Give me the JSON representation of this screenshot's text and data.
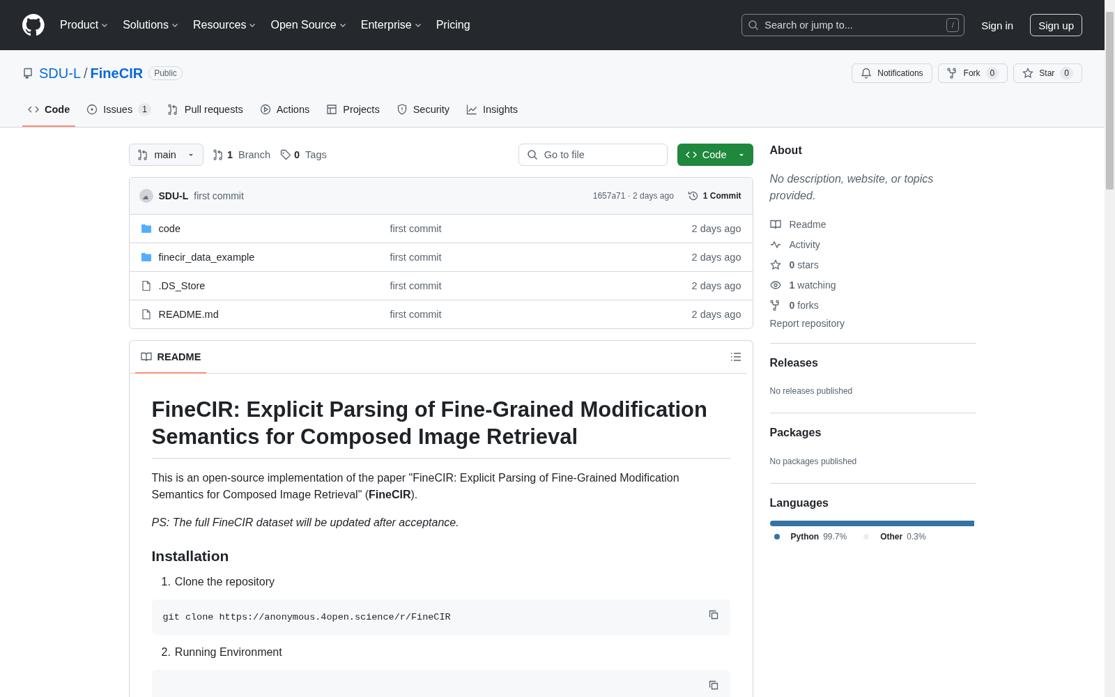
{
  "header": {
    "nav": [
      {
        "label": "Product",
        "caret": true
      },
      {
        "label": "Solutions",
        "caret": true
      },
      {
        "label": "Resources",
        "caret": true
      },
      {
        "label": "Open Source",
        "caret": true
      },
      {
        "label": "Enterprise",
        "caret": true
      },
      {
        "label": "Pricing",
        "caret": false
      }
    ],
    "search": {
      "placeholder": "Search or jump to...",
      "shortcut": "/"
    },
    "sign_in": "Sign in",
    "sign_up": "Sign up"
  },
  "repo": {
    "owner": "SDU-L",
    "separator": "/",
    "name": "FineCIR",
    "visibility": "Public",
    "actions": [
      {
        "kind": "bell",
        "label": "Notifications"
      },
      {
        "kind": "fork",
        "label": "Fork",
        "count": "0"
      },
      {
        "kind": "star",
        "label": "Star",
        "count": "0"
      }
    ]
  },
  "tabs": [
    {
      "kind": "code",
      "label": "Code",
      "selected": true
    },
    {
      "kind": "issue",
      "label": "Issues",
      "count": "1",
      "selected": false
    },
    {
      "kind": "pr",
      "label": "Pull requests",
      "selected": false
    },
    {
      "kind": "play",
      "label": "Actions",
      "selected": false
    },
    {
      "kind": "table",
      "label": "Projects",
      "selected": false
    },
    {
      "kind": "shield",
      "label": "Security",
      "selected": false
    },
    {
      "kind": "graph",
      "label": "Insights",
      "selected": false
    }
  ],
  "toolbar": {
    "branch": "main",
    "branches_count": "1",
    "branches_label": "Branch",
    "tags_count": "0",
    "tags_label": "Tags",
    "go_to_file": {
      "placeholder": "Go to file"
    },
    "code_button": "Code"
  },
  "commit": {
    "author": "SDU-L",
    "message": "first commit",
    "hash_time": "1657a71 · 2 days ago",
    "commits": "1 Commit"
  },
  "files": [
    {
      "kind": "folder",
      "name": "code",
      "message": "first commit",
      "time": "2 days ago"
    },
    {
      "kind": "folder",
      "name": "finecir_data_example",
      "message": "first commit",
      "time": "2 days ago"
    },
    {
      "kind": "file",
      "name": ".DS_Store",
      "message": "first commit",
      "time": "2 days ago"
    },
    {
      "kind": "file",
      "name": "README.md",
      "message": "first commit",
      "time": "2 days ago"
    }
  ],
  "readme": {
    "tab": "README",
    "title": "FineCIR: Explicit Parsing of Fine-Grained Modification Semantics for Composed Image Retrieval",
    "intro": "This is an open-source implementation of the paper \"FineCIR: Explicit Parsing of Fine-Grained Modification Semantics for Composed Image Retrieval\" (**FineCIR**).",
    "note": "PS: The full FineCIR dataset will be updated after acceptance.",
    "section": "Installation",
    "steps": [
      {
        "number": "1.",
        "text": "Clone the repository",
        "code": "git clone https://anonymous.4open.science/r/FineCIR"
      },
      {
        "number": "2.",
        "text": "Running Environment"
      }
    ]
  },
  "sidebar": {
    "about_title": "About",
    "about_text": "No description, website, or topics provided.",
    "links": [
      {
        "kind": "book",
        "label": "Readme"
      },
      {
        "kind": "pulse",
        "label": "Activity"
      },
      {
        "kind": "star",
        "count": "0",
        "label": "stars"
      },
      {
        "kind": "eye",
        "count": "1",
        "label": "watching"
      },
      {
        "kind": "fork",
        "count": "0",
        "label": "forks"
      }
    ],
    "report": "Report repository",
    "releases_title": "Releases",
    "releases_text": "No releases published",
    "packages_title": "Packages",
    "packages_text": "No packages published",
    "languages_title": "Languages",
    "languages": [
      {
        "name": "Python",
        "percent": "99.7%",
        "color": "#3572a5",
        "level": 0.997
      },
      {
        "name": "Other",
        "percent": "0.3%",
        "color": "#ededed",
        "level": 0.003
      }
    ]
  }
}
